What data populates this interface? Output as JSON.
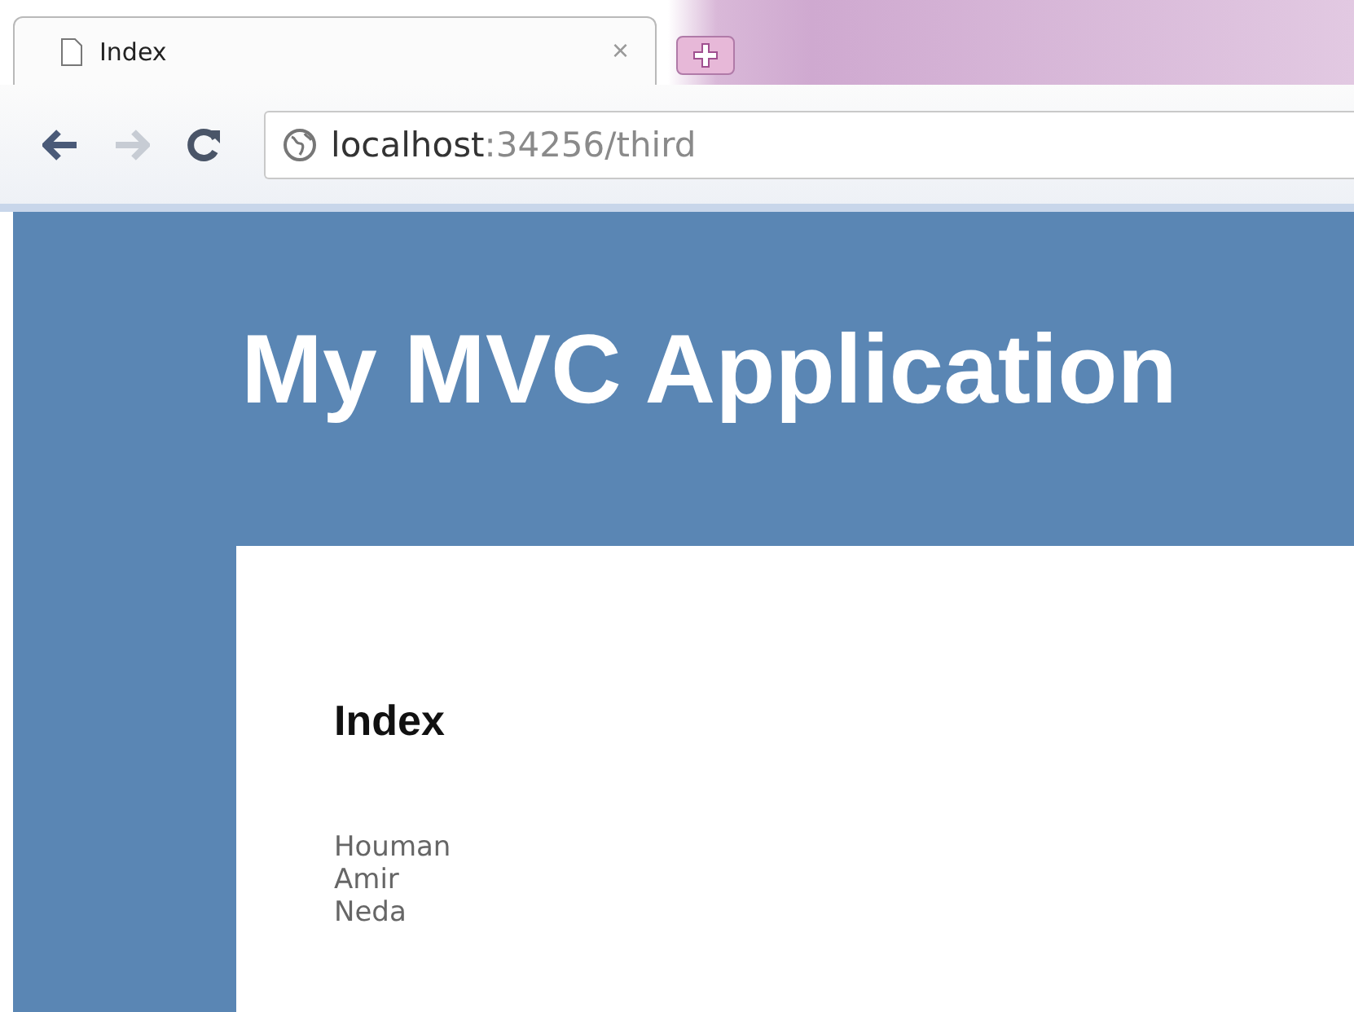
{
  "browser": {
    "tab": {
      "title": "Index",
      "close": "×",
      "selected": true
    },
    "nav": {
      "back_disabled": false,
      "forward_disabled": true
    },
    "address": {
      "host": "localhost",
      "rest": ":34256/third"
    }
  },
  "site": {
    "title": "My MVC Application"
  },
  "content": {
    "heading": "Index",
    "names": [
      "Houman",
      "Amir",
      "Neda"
    ]
  }
}
